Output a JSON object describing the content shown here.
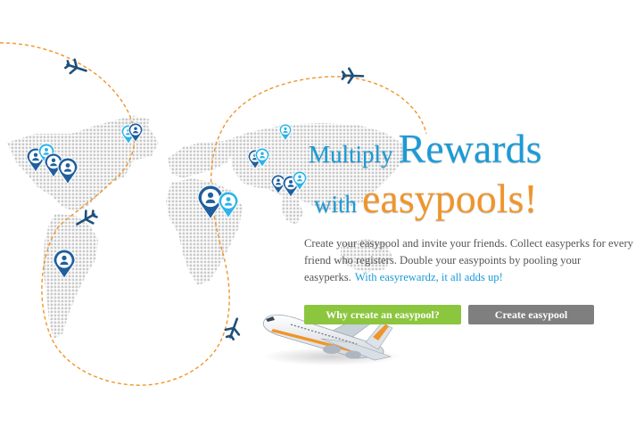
{
  "headline": {
    "line1_small": "Multiply",
    "line1_big": "Rewards",
    "line2_small": "with",
    "line2_big": "easypools!"
  },
  "description": {
    "body": "Create your easypool and invite your friends. Collect easyperks for every friend who registers. Double your easypoints by pooling your easyperks.",
    "tagline": "With easyrewardz, it all adds up!"
  },
  "buttons": {
    "why_label": "Why create an easypool?",
    "create_label": "Create easypool"
  },
  "colors": {
    "blue": "#1a9bd7",
    "orange": "#f0952a",
    "green_button": "#8cc63f",
    "gray_button": "#7f7f7f",
    "flight_path": "#f0952a",
    "pin_dark": "#1f5f9e",
    "pin_light": "#2db3e8"
  },
  "icons": [
    "plane-icon",
    "location-pin-icon",
    "world-map"
  ]
}
